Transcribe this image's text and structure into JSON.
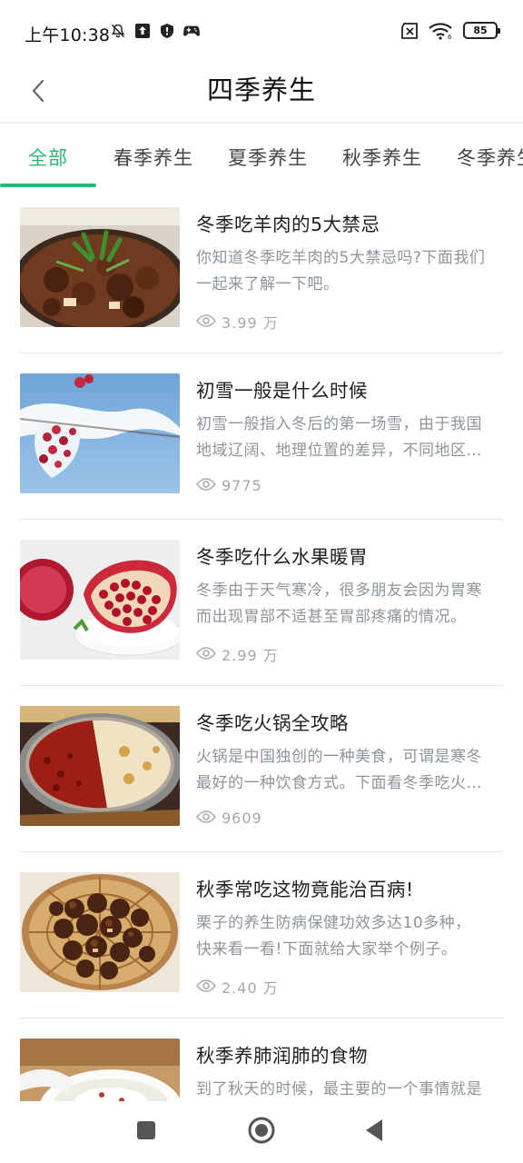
{
  "status_bar": {
    "time": "上午10:38",
    "battery": "85",
    "icons_left": [
      "mute-icon",
      "upload-icon",
      "shield-icon",
      "gamepad-icon"
    ],
    "icons_right": [
      "no-sim-icon",
      "wifi-icon",
      "battery-icon"
    ]
  },
  "header": {
    "title": "四季养生",
    "back_icon": "chevron-left-icon"
  },
  "tabs": [
    {
      "label": "全部",
      "active": true
    },
    {
      "label": "春季养生",
      "active": false
    },
    {
      "label": "夏季养生",
      "active": false
    },
    {
      "label": "秋季养生",
      "active": false
    },
    {
      "label": "冬季养生",
      "active": false
    }
  ],
  "colors": {
    "accent": "#2bb673",
    "title_text": "#1f1f1f",
    "summary_text": "#8d949e",
    "meta_text": "#a3a8ae",
    "divider": "#e3e3e3"
  },
  "articles": [
    {
      "title": "冬季吃羊肉的5大禁忌",
      "summary": "你知道冬季吃羊肉的5大禁忌吗?下面我们一起来了解一下吧。",
      "views": "3.99 万",
      "thumb": "lamb-stew-image"
    },
    {
      "title": "初雪一般是什么时候",
      "summary": "初雪一般指入冬后的第一场雪，由于我国地域辽阔、地理位置的差异，不同地区初雪时间也不同。",
      "views": "9775",
      "thumb": "snow-berries-image"
    },
    {
      "title": "冬季吃什么水果暖胃",
      "summary": "冬季由于天气寒冷，很多朋友会因为胃寒而出现胃部不适甚至胃部疼痛的情况。",
      "views": "2.99 万",
      "thumb": "pomegranate-image"
    },
    {
      "title": "冬季吃火锅全攻略",
      "summary": "火锅是中国独创的一种美食，可谓是寒冬最好的一种饮食方式。下面看冬季吃火锅全攻略。",
      "views": "9609",
      "thumb": "hotpot-image"
    },
    {
      "title": "秋季常吃这物竟能治百病!",
      "summary": "栗子的养生防病保健功效多达10多种，快来看一看!下面就给大家举个例子。",
      "views": "2.40 万",
      "thumb": "chestnuts-image"
    },
    {
      "title": "秋季养肺润肺的食物",
      "summary": "到了秋天的时候，最主要的一个事情就是养肺润肺。",
      "views": "",
      "thumb": "soup-image"
    }
  ],
  "nav": {
    "icons": [
      "recents-square-icon",
      "home-circle-icon",
      "back-triangle-icon"
    ]
  }
}
